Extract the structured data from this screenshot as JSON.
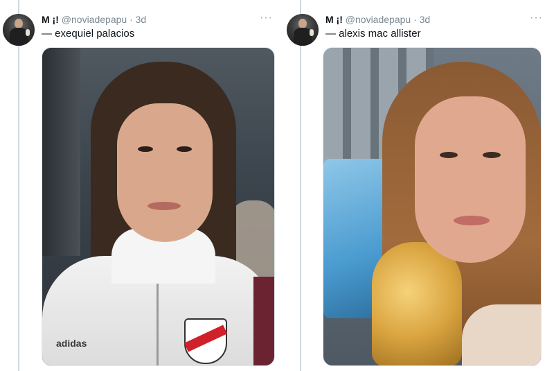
{
  "tweets": [
    {
      "author": {
        "name": "M ¡!",
        "handle": "@noviadepapu",
        "separator": "·",
        "time": "3d"
      },
      "more_label": "···",
      "text": "— exequiel palacios",
      "photo_brand": "adidas",
      "avatar_icon": "avatar",
      "more_icon": "more-options-icon"
    },
    {
      "author": {
        "name": "M ¡!",
        "handle": "@noviadepapu",
        "separator": "·",
        "time": "3d"
      },
      "more_label": "···",
      "text": "— alexis mac allister",
      "avatar_icon": "avatar",
      "more_icon": "more-options-icon"
    }
  ],
  "colors": {
    "text": "#0f1419",
    "secondary": "#7b8a95",
    "rail": "#cfd9de"
  }
}
